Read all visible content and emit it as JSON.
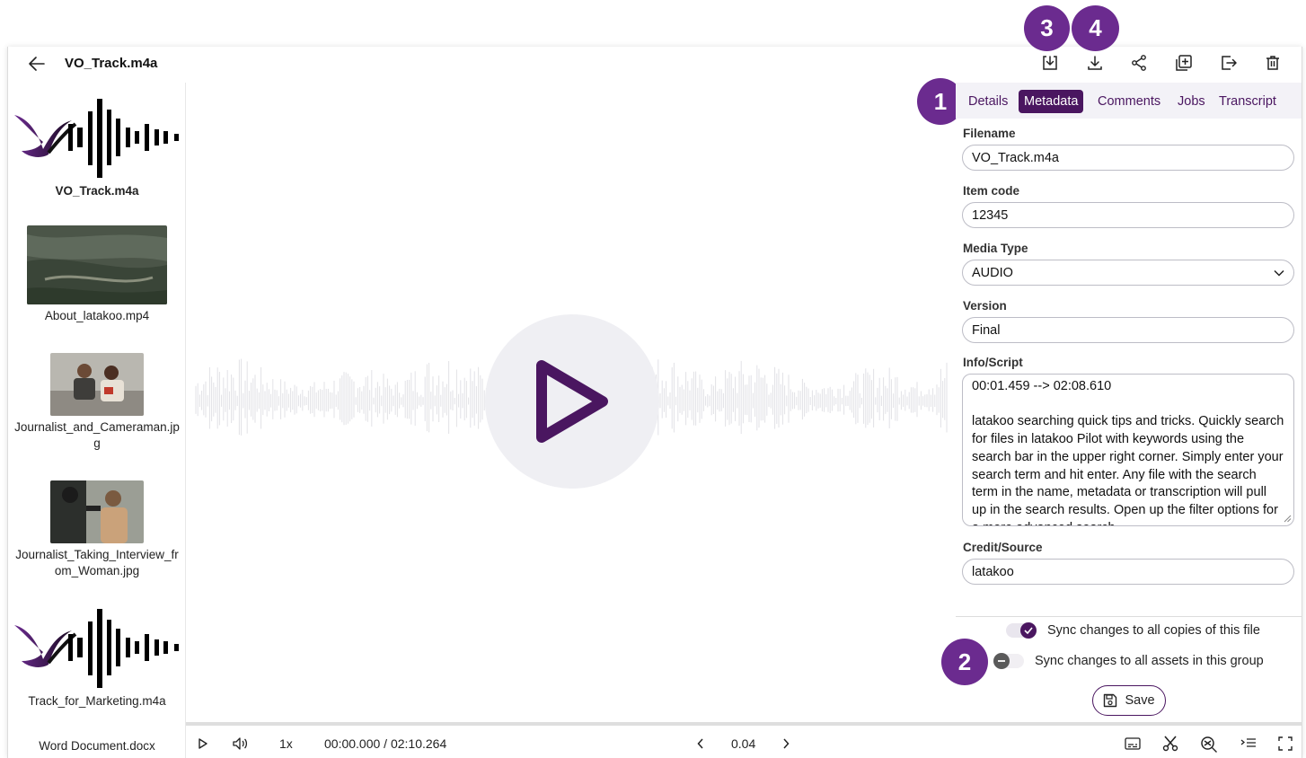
{
  "header": {
    "title": "VO_Track.m4a"
  },
  "badges": [
    "1",
    "2",
    "3",
    "4"
  ],
  "sidebar": {
    "items": [
      {
        "name": "VO_Track.m4a",
        "type": "audio"
      },
      {
        "name": "About_latakoo.mp4",
        "type": "video"
      },
      {
        "name": "Journalist_and_Cameraman.jp",
        "name2": "g",
        "type": "image"
      },
      {
        "name": "Journalist_Taking_Interview_fr",
        "name2": "om_Woman.jpg",
        "type": "image"
      },
      {
        "name": "Track_for_Marketing.m4a",
        "type": "audio"
      },
      {
        "name": "Word Document.docx",
        "type": "document"
      }
    ]
  },
  "tabs": [
    {
      "label": "Details"
    },
    {
      "label": "Metadata",
      "active": true
    },
    {
      "label": "Comments"
    },
    {
      "label": "Jobs"
    },
    {
      "label": "Transcript"
    }
  ],
  "form": {
    "filename_label": "Filename",
    "filename_value": "VO_Track.m4a",
    "item_code_label": "Item code",
    "item_code_value": "12345",
    "media_type_label": "Media Type",
    "media_type_value": "AUDIO",
    "version_label": "Version",
    "version_value": "Final",
    "info_label": "Info/Script",
    "info_value": "00:01.459 --> 02:08.610\n\nlatakoo searching quick tips and tricks. Quickly search for files in latakoo Pilot with keywords using the search bar in the upper right corner. Simply enter your search term and hit enter. Any file with the search term in the name, metadata or transcription will pull up in the search results. Open up the filter options for a more advanced search.",
    "credit_label": "Credit/Source",
    "credit_value": "latakoo"
  },
  "sync": {
    "copies_label": "Sync changes to all copies of this file",
    "copies_on": true,
    "group_label": "Sync changes to all assets in this group",
    "group_on": false
  },
  "save_label": "Save",
  "player": {
    "speed": "1x",
    "time": "00:00.000 / 02:10.264",
    "frame_step": "0.04",
    "progress": 0
  },
  "colors": {
    "brand": "#4a1660",
    "badge": "#6b2b8f"
  }
}
